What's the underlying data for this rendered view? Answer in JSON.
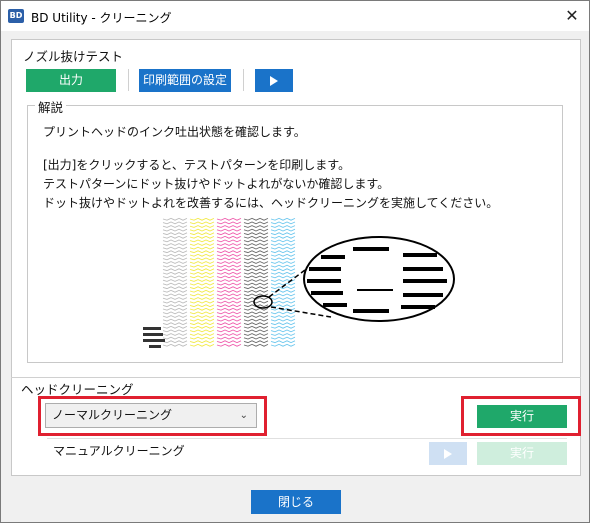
{
  "window": {
    "app_icon": "BD",
    "title": "BD Utility - クリーニング",
    "close_glyph": "✕"
  },
  "nozzle_test": {
    "title": "ノズル抜けテスト",
    "output_button": "出力",
    "print_range_button": "印刷範囲の設定",
    "play_icon": "play-icon"
  },
  "explanation": {
    "label": "解説",
    "line1": "プリントヘッドのインク吐出状態を確認します。",
    "line2": "[出力]をクリックすると、テストパターンを印刷します。",
    "line3": "テストパターンにドット抜けやドットよれがないか確認します。",
    "line4": "ドット抜けやドットよれを改善するには、ヘッドクリーニングを実施してください。",
    "colors": [
      "#bdbdbd",
      "#f2ea4a",
      "#ef5fae",
      "#6b6b6b",
      "#6fc8ee"
    ]
  },
  "head_cleaning": {
    "title": "ヘッドクリーニング",
    "selected_option": "ノーマルクリーニング",
    "run_button": "実行",
    "manual_label": "マニュアルクリーニング",
    "manual_run_button": "実行"
  },
  "footer": {
    "close_button": "閉じる"
  },
  "highlight_color": "#e02030"
}
